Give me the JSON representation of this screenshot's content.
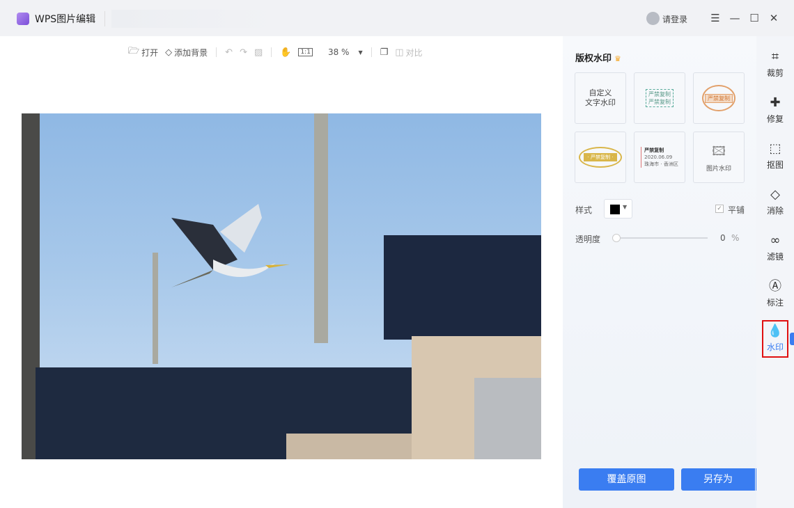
{
  "app": {
    "title": "WPS图片编辑",
    "login": "请登录"
  },
  "toolbar": {
    "open": "打开",
    "add_bg": "添加背景",
    "zoom": "38 %",
    "compare": "对比"
  },
  "panel": {
    "title": "版权水印",
    "cards": {
      "custom": [
        "自定义",
        "文字水印"
      ],
      "stamp1": [
        "严禁复制",
        "严禁复制"
      ],
      "stamp2": "严禁复制",
      "stamp3": "· 严禁复制 ·",
      "stamp4": [
        "严禁复制",
        "2020.06.09",
        "珠海市 · 香洲区"
      ],
      "image": "图片水印"
    },
    "style_label": "样式",
    "style_color": "#000000",
    "tile_label": "平铺",
    "tile_checked": true,
    "opacity_label": "透明度",
    "opacity_value": "0",
    "opacity_unit": "%",
    "overwrite": "覆盖原图",
    "save_as": "另存为"
  },
  "rail": [
    {
      "label": "裁剪",
      "icon": "crop-icon"
    },
    {
      "label": "修复",
      "icon": "bandage-icon"
    },
    {
      "label": "抠图",
      "icon": "cutout-icon"
    },
    {
      "label": "消除",
      "icon": "eraser-icon"
    },
    {
      "label": "滤镜",
      "icon": "filter-icon"
    },
    {
      "label": "标注",
      "icon": "annotate-icon"
    },
    {
      "label": "水印",
      "icon": "watermark-icon",
      "active": true
    }
  ],
  "colors": {
    "accent": "#3a7df1",
    "highlight": "#e01010",
    "crown": "#f5a623"
  }
}
